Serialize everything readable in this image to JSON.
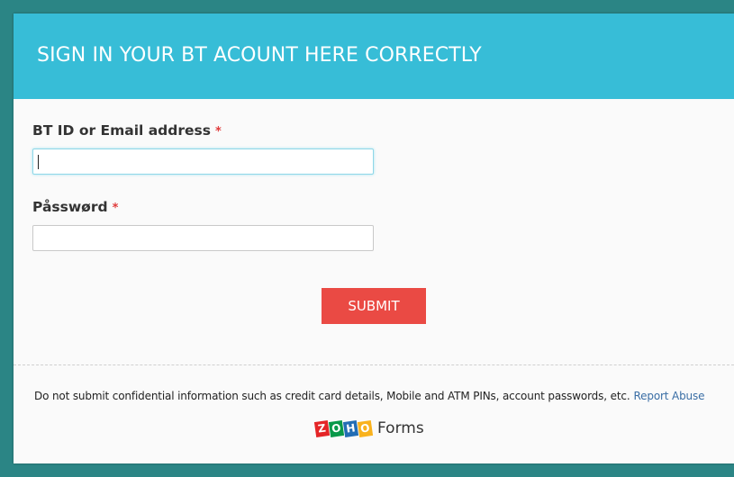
{
  "form": {
    "title": "SIGN IN YOUR BT ACOUNT HERE CORRECTLY",
    "fields": [
      {
        "label": "BT ID or Email address",
        "required_mark": "*",
        "value": ""
      },
      {
        "label": "Påsswørd",
        "required_mark": "*",
        "value": ""
      }
    ],
    "submit_label": "SUBMIT"
  },
  "footer": {
    "disclaimer": "Do not submit confidential information such as credit card details, Mobile and ATM PINs, account passwords, etc.",
    "report_link": "Report Abuse",
    "brand": {
      "logo_letters": [
        "Z",
        "O",
        "H",
        "O"
      ],
      "logo_colors": [
        "#e42527",
        "#089949",
        "#226db4",
        "#f9b21d"
      ],
      "product": "Forms"
    }
  },
  "colors": {
    "page_background": "#2b8585",
    "header": "#37bdd7",
    "submit": "#ea4a44",
    "required": "#e03b3b",
    "link": "#3a6ea5"
  }
}
